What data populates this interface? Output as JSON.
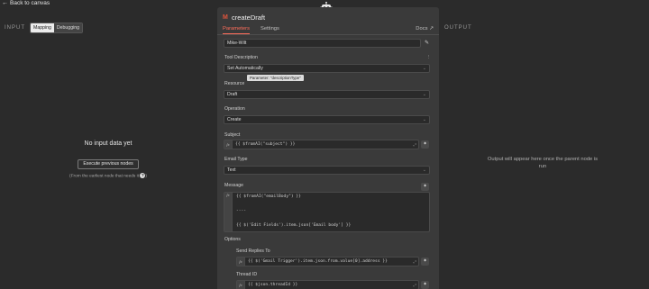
{
  "topbar": {
    "back_label": "Back to canvas"
  },
  "input_panel": {
    "label": "INPUT",
    "toggle": {
      "mapping": "Mapping",
      "debugging": "Debugging",
      "active": "mapping"
    },
    "empty_title": "No input data yet",
    "execute_button": "Execute previous nodes",
    "hint": "(From the earliest node that needs it",
    "hint_icon": "question-icon"
  },
  "output_panel": {
    "label": "OUTPUT",
    "message": "Output will appear here once the parent node is run"
  },
  "node": {
    "title": "createDraft",
    "icon": "gmail-icon",
    "tabs": [
      {
        "label": "Parameters",
        "active": true
      },
      {
        "label": "Settings",
        "active": false
      }
    ],
    "docs_label": "Docs",
    "credential": {
      "value": "Mike-Wilt",
      "edit_icon": "pencil-icon"
    },
    "tool_description": {
      "label": "Tool Description",
      "value": "Set Automatically"
    },
    "tooltip": "Parameter: \"descriptionType\"",
    "resource": {
      "label": "Resource",
      "value": "Draft"
    },
    "operation": {
      "label": "Operation",
      "value": "Create"
    },
    "subject": {
      "label": "Subject",
      "value": "{{ $fromAI(\"subject\") }}"
    },
    "email_type": {
      "label": "Email Type",
      "value": "Text"
    },
    "message": {
      "label": "Message",
      "lines": [
        "{{ $fromAI(\"emailBody\") }}",
        "----",
        "{{ $('Edit Fields').item.json['Email body'] }}"
      ]
    },
    "options": {
      "label": "Options",
      "send_replies_to": {
        "label": "Send Replies To",
        "value": "{{ $('Gmail Trigger').item.json.from.value[0].address }}"
      },
      "thread_id": {
        "label": "Thread ID",
        "value": "{{ $json.threadId }}"
      }
    }
  },
  "colors": {
    "accent": "#ff6d5a",
    "background": "#2b2b2b",
    "panel": "#3a3a3a"
  }
}
